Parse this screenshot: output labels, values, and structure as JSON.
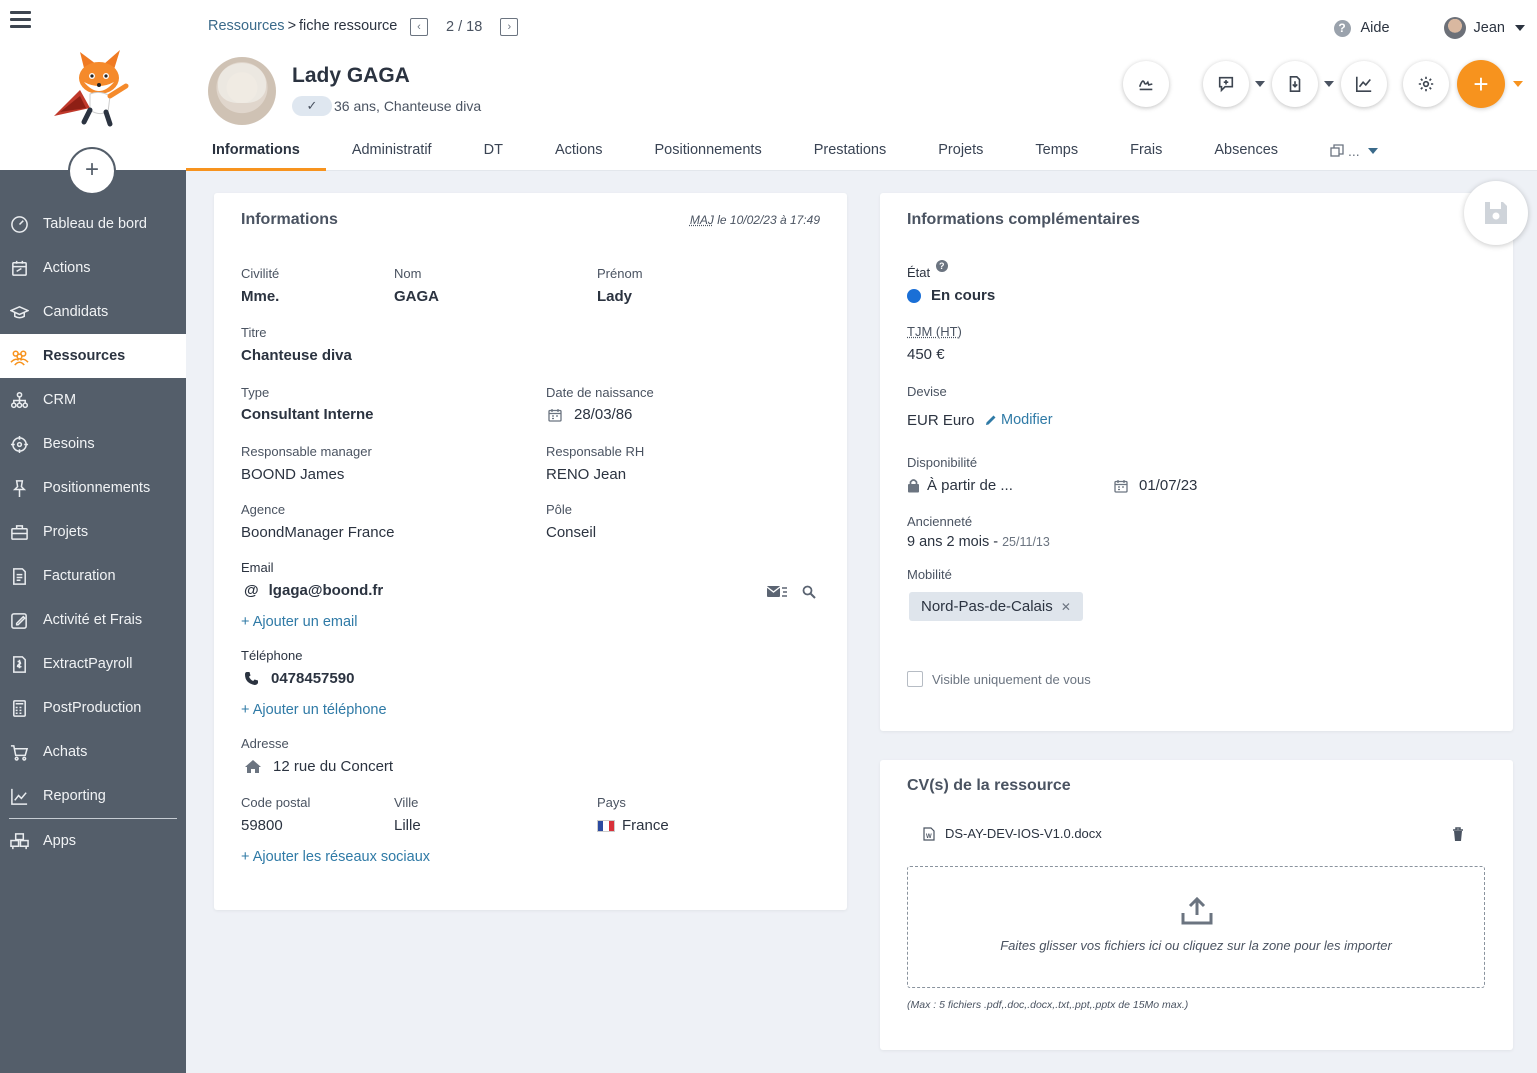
{
  "sidebar": {
    "items": [
      {
        "label": "Tableau de bord",
        "icon": "dashboard-icon"
      },
      {
        "label": "Actions",
        "icon": "actions-icon"
      },
      {
        "label": "Candidats",
        "icon": "graduation-cap-icon"
      },
      {
        "label": "Ressources",
        "icon": "people-icon",
        "active": true
      },
      {
        "label": "CRM",
        "icon": "org-chart-icon"
      },
      {
        "label": "Besoins",
        "icon": "target-icon"
      },
      {
        "label": "Positionnements",
        "icon": "pin-icon"
      },
      {
        "label": "Projets",
        "icon": "briefcase-icon"
      },
      {
        "label": "Facturation",
        "icon": "invoice-icon"
      },
      {
        "label": "Activité et Frais",
        "icon": "edit-icon"
      },
      {
        "label": "ExtractPayroll",
        "icon": "payroll-icon"
      },
      {
        "label": "PostProduction",
        "icon": "calculator-icon"
      },
      {
        "label": "Achats",
        "icon": "cart-icon"
      },
      {
        "label": "Reporting",
        "icon": "chart-icon"
      },
      {
        "label": "Apps",
        "icon": "apps-icon"
      }
    ]
  },
  "header": {
    "breadcrumb_link": "Ressources",
    "breadcrumb_current": "fiche ressource",
    "pager": "2 / 18",
    "help_label": "Aide",
    "user_name": "Jean",
    "person_name": "Lady GAGA",
    "person_sub": "36 ans, Chanteuse diva"
  },
  "tabs": [
    "Informations",
    "Administratif",
    "DT",
    "Actions",
    "Positionnements",
    "Prestations",
    "Projets",
    "Temps",
    "Frais",
    "Absences"
  ],
  "tab_more": "...",
  "info": {
    "title": "Informations",
    "updated_prefix": "MAJ",
    "updated": "le 10/02/23 à 17:49",
    "civilite_label": "Civilité",
    "civilite": "Mme.",
    "nom_label": "Nom",
    "nom": "GAGA",
    "prenom_label": "Prénom",
    "prenom": "Lady",
    "titre_label": "Titre",
    "titre": "Chanteuse diva",
    "type_label": "Type",
    "type": "Consultant Interne",
    "naissance_label": "Date de naissance",
    "naissance": "28/03/86",
    "resp_manager_label": "Responsable manager",
    "resp_manager": "BOOND James",
    "resp_rh_label": "Responsable RH",
    "resp_rh": "RENO Jean",
    "agence_label": "Agence",
    "agence": "BoondManager France",
    "pole_label": "Pôle",
    "pole": "Conseil",
    "email_label": "Email",
    "email": "lgaga@boond.fr",
    "add_email": "+ Ajouter un email",
    "tel_label": "Téléphone",
    "tel": "0478457590",
    "add_tel": "+ Ajouter un téléphone",
    "adresse_label": "Adresse",
    "adresse": "12 rue du Concert",
    "cp_label": "Code postal",
    "cp": "59800",
    "ville_label": "Ville",
    "ville": "Lille",
    "pays_label": "Pays",
    "pays": "France",
    "add_social": "+ Ajouter les réseaux sociaux"
  },
  "compl": {
    "title": "Informations complémentaires",
    "etat_label": "État",
    "etat": "En cours",
    "etat_color": "#1a6fd6",
    "tjm_label": "TJM (HT)",
    "tjm": "450 €",
    "devise_label": "Devise",
    "devise": "EUR Euro",
    "modifier": "Modifier",
    "dispo_label": "Disponibilité",
    "dispo": "À partir de ...",
    "dispo_date": "01/07/23",
    "anciennete_label": "Ancienneté",
    "anciennete": "9 ans 2 mois -",
    "anciennete_date": "25/11/13",
    "mobilite_label": "Mobilité",
    "mobilite": "Nord-Pas-de-Calais",
    "visible_label": "Visible uniquement de vous"
  },
  "cv": {
    "title": "CV(s) de la ressource",
    "file": "DS-AY-DEV-IOS-V1.0.docx",
    "dropzone_text": "Faites glisser vos fichiers ici ou cliquez sur la zone pour les importer",
    "limit_text": "(Max : 5 fichiers .pdf,.doc,.docx,.txt,.ppt,.pptx de 15Mo max.)"
  },
  "colors": {
    "accent": "#f7931e",
    "sidebar": "#545e6a",
    "link": "#2f7aa6"
  }
}
